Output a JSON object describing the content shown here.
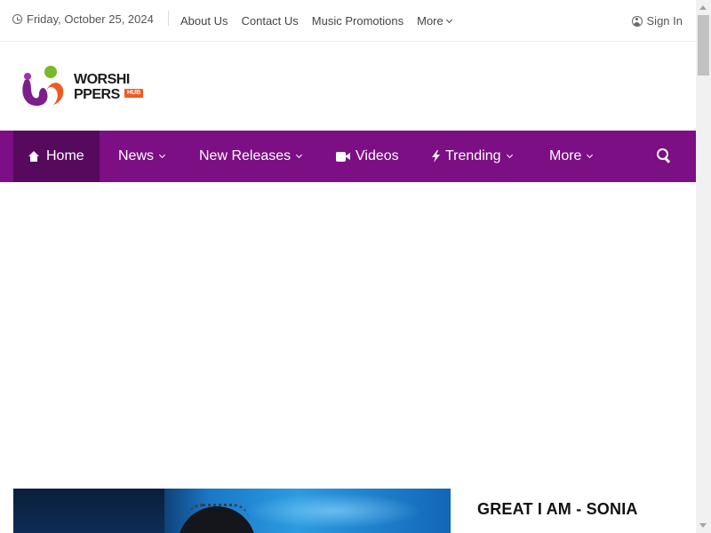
{
  "topbar": {
    "date": "Friday, October 25, 2024",
    "links": [
      "About Us",
      "Contact Us",
      "Music Promotions",
      "More"
    ],
    "signin": "Sign In"
  },
  "logo": {
    "line1": "WORSHI",
    "line2": "PPERS",
    "badge": "HUB",
    "colors": {
      "purple": "#7b1f8a",
      "orange": "#f05a22",
      "green": "#7ab929"
    }
  },
  "nav": {
    "items": [
      "Home",
      "News",
      "New Releases",
      "Videos",
      "Trending",
      "More"
    ],
    "bar_color": "#7b0f83",
    "active_color": "#57095d"
  },
  "feature": {
    "title": "GREAT I AM - SONIA"
  }
}
